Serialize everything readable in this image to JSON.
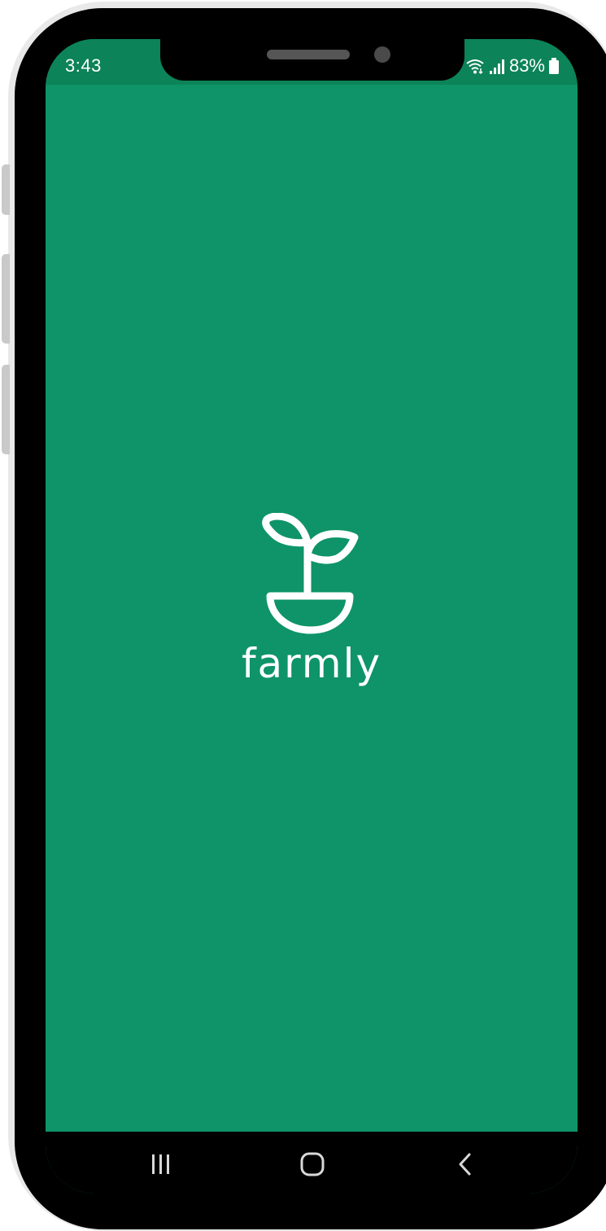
{
  "status_bar": {
    "time": "3:43",
    "battery_text": "83%",
    "icons": [
      "wifi-icon",
      "signal-icon",
      "battery-icon"
    ]
  },
  "splash": {
    "app_name": "farmly",
    "logo_icon": "sprout-pot-icon",
    "background_color": "#0e9468",
    "status_bar_color": "#0c8358"
  },
  "navigation_bar": {
    "buttons": [
      "recent-apps-icon",
      "home-icon",
      "back-icon"
    ]
  }
}
